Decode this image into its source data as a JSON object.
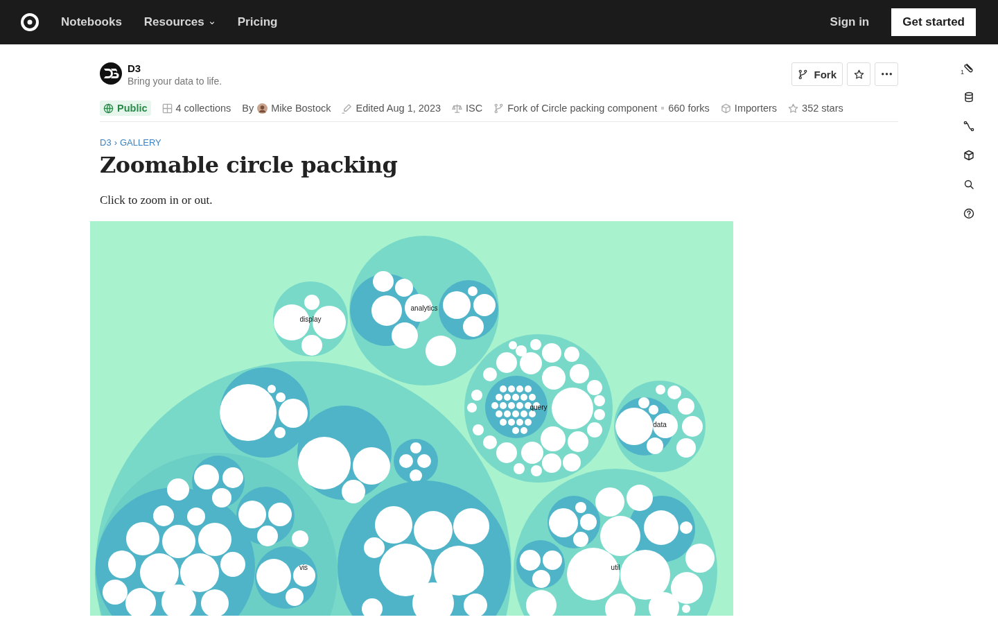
{
  "nav": {
    "links": [
      {
        "label": "Notebooks",
        "kind": "link"
      },
      {
        "label": "Resources",
        "kind": "menu"
      },
      {
        "label": "Pricing",
        "kind": "link"
      }
    ],
    "sign_in": "Sign in",
    "get_started": "Get started"
  },
  "notebook": {
    "owner": "D3",
    "tagline": "Bring your data to life.",
    "actions": [
      {
        "kind": "fork",
        "label": "Fork"
      },
      {
        "kind": "star"
      },
      {
        "kind": "more"
      }
    ],
    "meta": [
      {
        "kind": "visibility",
        "label": "Public"
      },
      {
        "kind": "collections",
        "label": "4 collections"
      },
      {
        "kind": "author",
        "prefix": "By",
        "label": "Mike Bostock"
      },
      {
        "kind": "edited",
        "label": "Edited Aug 1, 2023"
      },
      {
        "kind": "license",
        "label": "ISC"
      },
      {
        "kind": "fork_of",
        "label": "Fork of Circle packing component"
      },
      {
        "kind": "forks",
        "label": "660 forks"
      },
      {
        "kind": "importers",
        "label": "Importers"
      },
      {
        "kind": "stars",
        "label": "352 stars"
      }
    ]
  },
  "breadcrumb": {
    "items": [
      "D3",
      "GALLERY"
    ],
    "separator": "›"
  },
  "title": "Zoomable circle packing",
  "description": "Click to zoom in or out.",
  "chart": {
    "labels": [
      "display",
      "analytics",
      "query",
      "data",
      "vis",
      "util"
    ]
  },
  "sidebar": {
    "tools": [
      {
        "kind": "files",
        "badge": "1"
      },
      {
        "kind": "database"
      },
      {
        "kind": "path"
      },
      {
        "kind": "package"
      },
      {
        "kind": "search"
      },
      {
        "kind": "help"
      }
    ]
  }
}
